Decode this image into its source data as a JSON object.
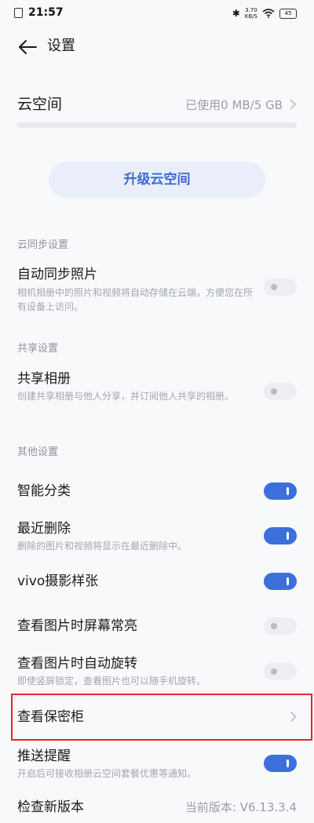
{
  "status_bar": {
    "time": "21:57",
    "speed": "3.70\nKB/S",
    "battery": "45"
  },
  "nav": {
    "title": "设置",
    "back_icon": "arrow-left-icon"
  },
  "cloud": {
    "title": "云空间",
    "usage": "已使用0 MB/5 GB",
    "used_fraction": 0.0,
    "upgrade_label": "升级云空间"
  },
  "sections": {
    "sync": {
      "header": "云同步设置",
      "auto_sync_title": "自动同步照片",
      "auto_sync_desc": "相机相册中的照片和视频将自动存储在云端，方便您在所有设备上访问。",
      "auto_sync_on": false
    },
    "share": {
      "header": "共享设置",
      "shared_album_title": "共享相册",
      "shared_album_desc": "创建共享相册与他人分享，并订阅他人共享的相册。",
      "shared_album_on": false
    },
    "other": {
      "header": "其他设置",
      "smart_title": "智能分类",
      "smart_on": true,
      "recent_title": "最近删除",
      "recent_desc": "删除的图片和视频将显示在最近删除中。",
      "recent_on": true,
      "vivo_title": "vivo摄影样张",
      "vivo_on": true,
      "screen_on_title": "查看图片时屏幕常亮",
      "screen_on_on": false,
      "auto_rotate_title": "查看图片时自动旋转",
      "auto_rotate_desc": "即使竖屏锁定，查看图片也可以随手机旋转。",
      "auto_rotate_on": false,
      "safe_title": "查看保密柜",
      "push_title": "推送提醒",
      "push_desc": "开启后可接收相册云空间套餐优惠等通知。",
      "push_on": true,
      "update_title": "检查新版本",
      "update_version": "当前版本: V6.13.3.4"
    }
  },
  "colors": {
    "accent": "#3d6fdc",
    "highlight": "#e0282f"
  }
}
